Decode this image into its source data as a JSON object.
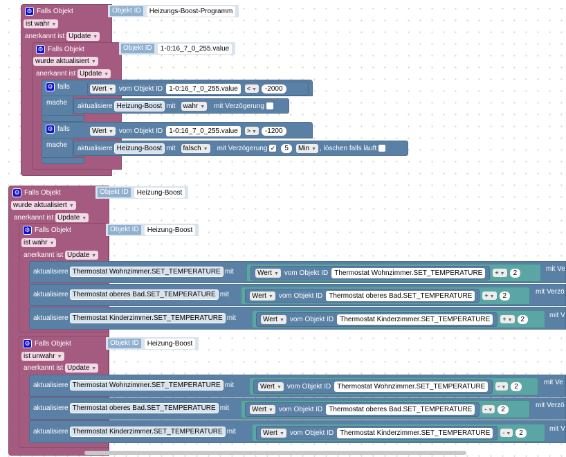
{
  "block1": {
    "header": "Falls Objekt",
    "obj_label": "Objekt ID",
    "obj_id": "Heizungs-Boost-Programm",
    "cond": "ist wahr",
    "ack_label": "anerkannt ist",
    "ack_value": "Update",
    "inner": {
      "header": "Falls Objekt",
      "obj_label": "Objekt ID",
      "obj_id": "1-0:16_7_0_255.value",
      "cond": "wurde aktualisiert",
      "ack_label": "anerkannt ist",
      "ack_value": "Update",
      "if1": {
        "falls": "falls",
        "mache": "mache",
        "wert": "Wert",
        "vom": "vom Objekt ID",
        "obj": "1-0:16_7_0_255.value",
        "op": "<",
        "num": "-2000",
        "akt": "aktualisiere",
        "target": "Heizung-Boost",
        "mit": "mit",
        "val": "wahr",
        "delay": "mit Verzögerung"
      },
      "if2": {
        "falls": "falls",
        "mache": "mache",
        "wert": "Wert",
        "vom": "vom Objekt ID",
        "obj": "1-0:16_7_0_255.value",
        "op": ">",
        "num": "-1200",
        "akt": "aktualisiere",
        "target": "Heizung-Boost",
        "mit": "mit",
        "val": "falsch",
        "delay": "mit Verzögerung",
        "check": "✓",
        "delay_num": "5",
        "unit": "Min",
        "clear": ", löschen falls läuft"
      }
    }
  },
  "block2": {
    "header": "Falls Objekt",
    "obj_label": "Objekt ID",
    "obj_id": "Heizung-Boost",
    "cond": "wurde aktualisiert",
    "ack_label": "anerkannt ist",
    "ack_value": "Update",
    "inner_true": {
      "header": "Falls Objekt",
      "obj_label": "Objekt ID",
      "obj_id": "Heizung-Boost",
      "cond": "ist wahr",
      "ack_label": "anerkannt ist",
      "ack_value": "Update",
      "op": "+"
    },
    "inner_false": {
      "header": "Falls Objekt",
      "obj_label": "Objekt ID",
      "obj_id": "Heizung-Boost",
      "cond": "ist unwahr",
      "ack_label": "anerkannt ist",
      "ack_value": "Update",
      "op": "-"
    },
    "rows": [
      {
        "target": "Thermostat Wohnzimmer.SET_TEMPERATURE",
        "tail": "mit Ve"
      },
      {
        "target": "Thermostat oberes Bad.SET_TEMPERATURE",
        "tail": "mit Verzö"
      },
      {
        "target": "Thermostat Kinderzimmer.SET_TEMPERATURE",
        "tail": "mit V"
      }
    ],
    "akt": "aktualisiere",
    "mit": "mit",
    "wert": "Wert",
    "vom": "vom Objekt ID",
    "num": "2"
  },
  "colors": {
    "event": "#a55b80",
    "control": "#5b80a5",
    "math": "#5ba5a5"
  }
}
